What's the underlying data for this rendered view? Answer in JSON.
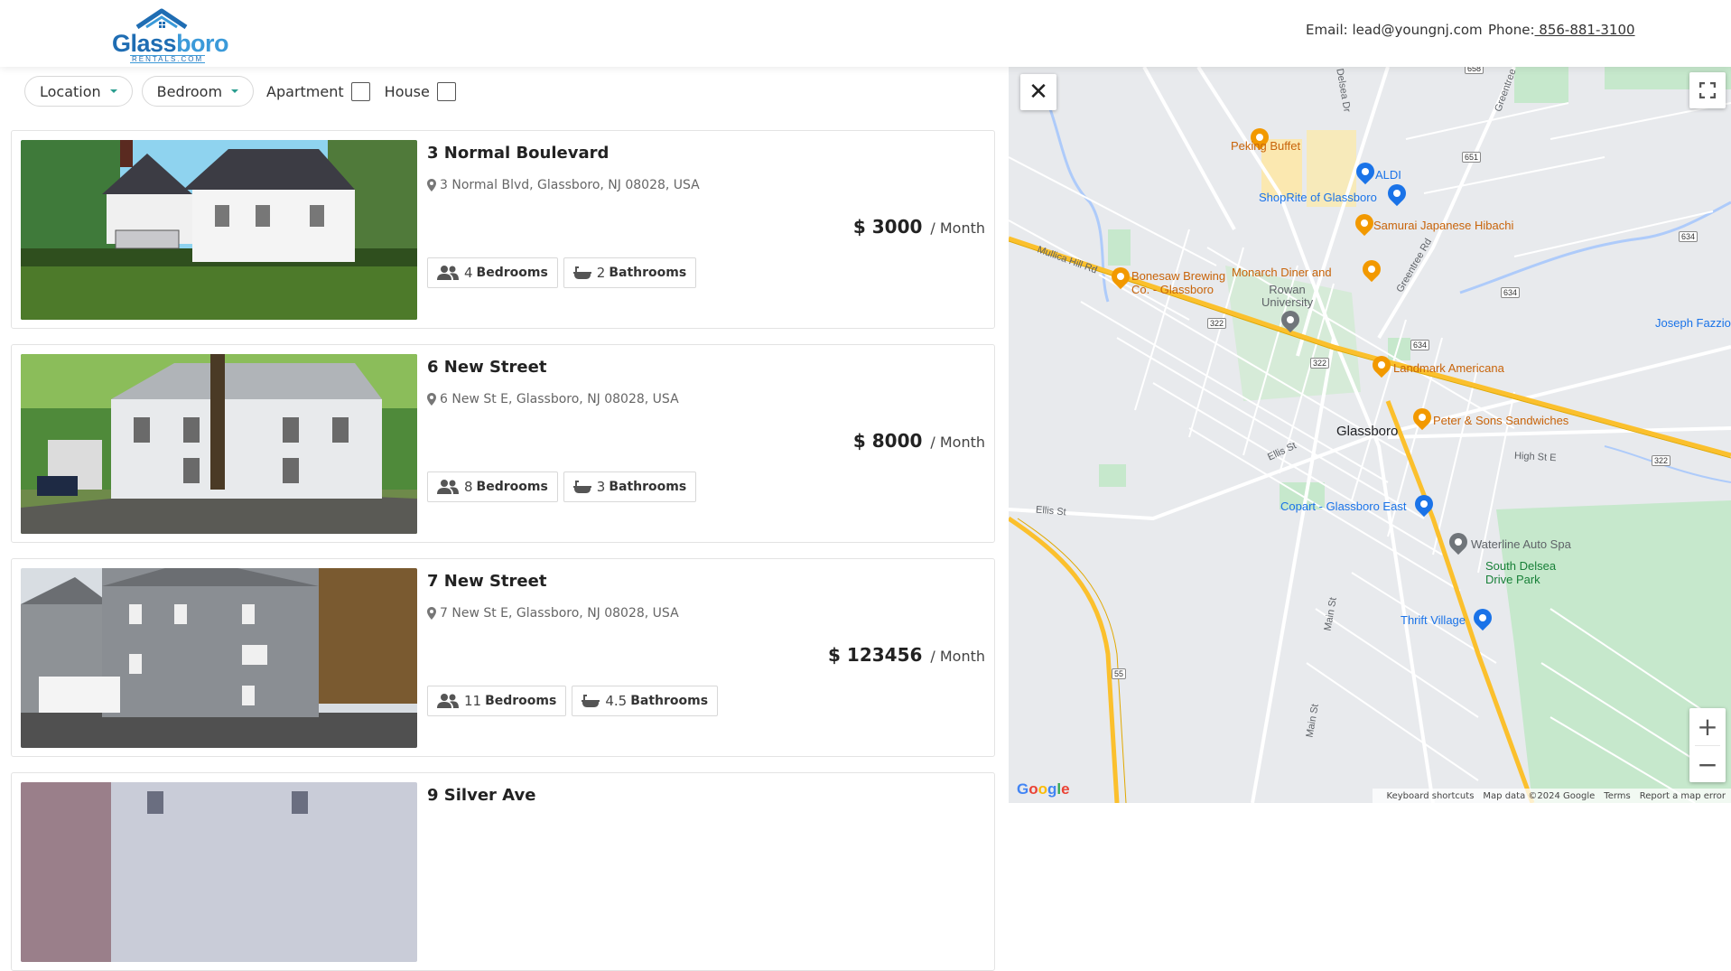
{
  "header": {
    "logo": {
      "word_a": "Glass",
      "word_b": "boro",
      "sub": "RENTALS.COM"
    },
    "email_label": "Email: lead@youngnj.com",
    "phone_label": "Phone:",
    "phone_value": " 856-881-3100"
  },
  "filters": {
    "location_label": "Location",
    "bedroom_label": "Bedroom",
    "apartment_label": "Apartment",
    "house_label": "House"
  },
  "listings": [
    {
      "title": "3 Normal Boulevard",
      "address": "3 Normal Blvd, Glassboro, NJ 08028, USA",
      "price": "$ 3000",
      "per": "/ Month",
      "bedrooms": "4",
      "bathrooms": "2"
    },
    {
      "title": "6 New Street",
      "address": "6 New St E, Glassboro, NJ 08028, USA",
      "price": "$ 8000",
      "per": "/ Month",
      "bedrooms": "8",
      "bathrooms": "3"
    },
    {
      "title": "7 New Street",
      "address": "7 New St E, Glassboro, NJ 08028, USA",
      "price": "$ 123456",
      "per": "/ Month",
      "bedrooms": "11",
      "bathrooms": "4.5"
    },
    {
      "title": "9 Silver Ave"
    }
  ],
  "labels": {
    "bedrooms": "Bedrooms",
    "bathrooms": "Bathrooms"
  },
  "map": {
    "close": "✕",
    "zoom_in": "+",
    "zoom_out": "−",
    "google": "Google",
    "attribution": {
      "shortcuts": "Keyboard shortcuts",
      "data": "Map data ©2024 Google",
      "terms": "Terms",
      "report": "Report a map error"
    },
    "places": {
      "peking": "Peking Buffet",
      "aldi": "ALDI",
      "shoprite": "ShopRite of Glassboro",
      "samurai": "Samurai Japanese Hibachi",
      "bonesaw": "Bonesaw Brewing\nCo. - Glassboro",
      "monarch": "Monarch Diner and",
      "rowan": "Rowan\nUniversity",
      "landmark": "Landmark Americana",
      "peter": "Peter & Sons Sandwiches",
      "glassboro": "Glassboro",
      "copart": "Copart - Glassboro East",
      "waterline": "Waterline Auto Spa",
      "sdelsea": "South Delsea\nDrive Park",
      "thrift": "Thrift Village",
      "joseph": "Joseph Fazzio"
    },
    "roads": {
      "delsea": "Delsea Dr",
      "greentree": "Greentree Rd",
      "greentree2": "Greentree Rd",
      "mullica": "Mullica Hill Rd",
      "ellis": "Ellis St",
      "ellis2": "Ellis St",
      "highst": "High St E",
      "mainst": "Main St",
      "mainst2": "Main St"
    },
    "shields": {
      "s658": "658",
      "s651": "651",
      "s634a": "634",
      "s634b": "634",
      "s634c": "634",
      "s322a": "322",
      "s322b": "322",
      "s322c": "322",
      "s55": "55"
    }
  }
}
